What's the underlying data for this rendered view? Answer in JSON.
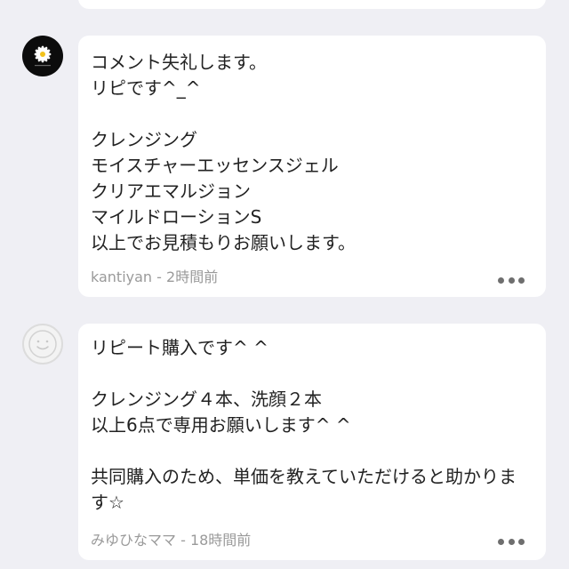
{
  "comments": [
    {
      "text": "コメント失礼します。\nリピです^_^\n\nクレンジング\nモイスチャーエッセンスジェル\nクリアエマルジョン\nマイルドローションS\n以上でお見積もりお願いします。",
      "meta": "kantiyan - 2時間前",
      "avatar_icon": "daisy-avatar-icon",
      "more_icon": "more-options-icon"
    },
    {
      "text": "リピート購入です^ ^\n\nクレンジング４本、洗顔２本\n以上6点で専用お願いします^ ^\n\n共同購入のため、単価を教えていただけると助かります☆",
      "meta": "みゆひなママ - 18時間前",
      "avatar_icon": "default-avatar-icon",
      "more_icon": "more-options-icon"
    }
  ],
  "colors": {
    "background": "#efeff4",
    "card": "#ffffff",
    "text": "#222222",
    "meta": "#9a9a9a",
    "dots": "#6e6e6e"
  }
}
